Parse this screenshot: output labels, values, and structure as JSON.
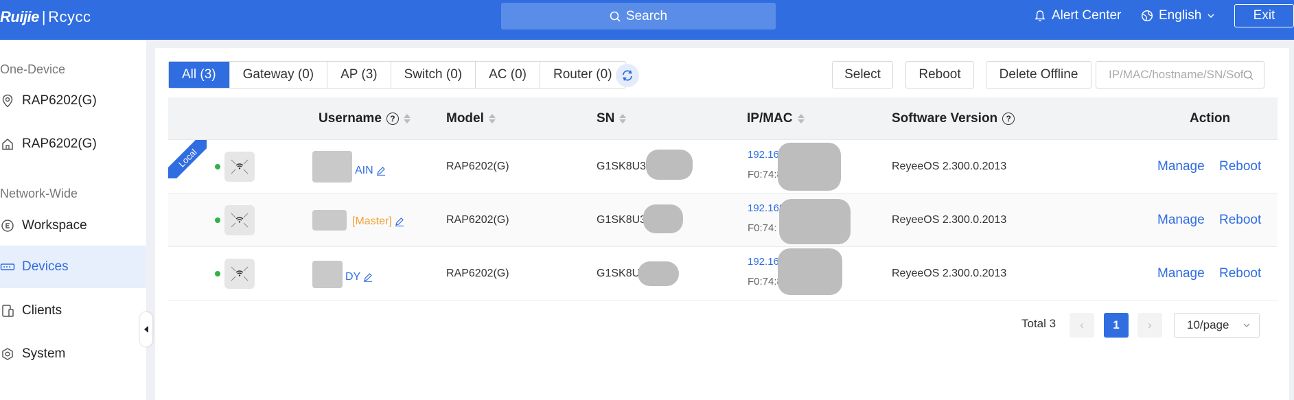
{
  "header": {
    "logo_brand": "Ruijie",
    "logo_separator": "|",
    "logo_brand2": "Rcycc",
    "search_label": "Search",
    "alert_center": "Alert Center",
    "language": "English",
    "exit": "Exit",
    "colors": {
      "bar": "#2f6de1",
      "search_bg": "#5a8de8"
    }
  },
  "sidebar": {
    "section_one_device": "One-Device",
    "one_device_items": [
      {
        "label": "RAP6202(G)",
        "icon": "location-pin-icon"
      },
      {
        "label": "RAP6202(G)",
        "icon": "home-icon"
      }
    ],
    "section_network_wide": "Network-Wide",
    "network_items": [
      {
        "label": "Workspace",
        "icon": "workspace-icon",
        "active": false
      },
      {
        "label": "Devices",
        "icon": "devices-icon",
        "active": true
      },
      {
        "label": "Clients",
        "icon": "clients-icon",
        "active": false
      },
      {
        "label": "System",
        "icon": "system-gear-icon",
        "active": false
      }
    ]
  },
  "toolbar": {
    "tabs": [
      {
        "label": "All (3)",
        "active": true
      },
      {
        "label": "Gateway (0)",
        "active": false
      },
      {
        "label": "AP (3)",
        "active": false
      },
      {
        "label": "Switch (0)",
        "active": false
      },
      {
        "label": "AC (0)",
        "active": false
      },
      {
        "label": "Router (0)",
        "active": false
      }
    ],
    "select": "Select",
    "reboot": "Reboot",
    "delete_offline": "Delete Offline",
    "search_placeholder": "IP/MAC/hostname/SN/Software"
  },
  "table": {
    "columns": {
      "username": "Username",
      "model": "Model",
      "sn": "SN",
      "ipmac": "IP/MAC",
      "software_version": "Software Version",
      "action": "Action"
    },
    "local_badge": "Local",
    "rows": [
      {
        "username_visible": "AIN",
        "master_tag": "",
        "model": "RAP6202(G)",
        "sn": "G1SK8U37",
        "ip": "192.16",
        "mac": "F0:74:8",
        "software_version": "ReyeeOS 2.300.0.2013",
        "manage": "Manage",
        "reboot": "Reboot"
      },
      {
        "username_visible": "",
        "master_tag": "[Master]",
        "model": "RAP6202(G)",
        "sn": "G1SK8U3",
        "ip": "192.168",
        "mac": "F0:74:",
        "software_version": "ReyeeOS 2.300.0.2013",
        "manage": "Manage",
        "reboot": "Reboot"
      },
      {
        "username_visible": "DY",
        "master_tag": "",
        "model": "RAP6202(G)",
        "sn": "G1SK8U",
        "ip": "192.16",
        "mac": "F0:74:8",
        "software_version": "ReyeeOS 2.300.0.2013",
        "manage": "Manage",
        "reboot": "Reboot"
      }
    ]
  },
  "pagination": {
    "total_label": "Total 3",
    "prev": "‹",
    "current_page": "1",
    "next": "›",
    "page_size": "10/page"
  }
}
